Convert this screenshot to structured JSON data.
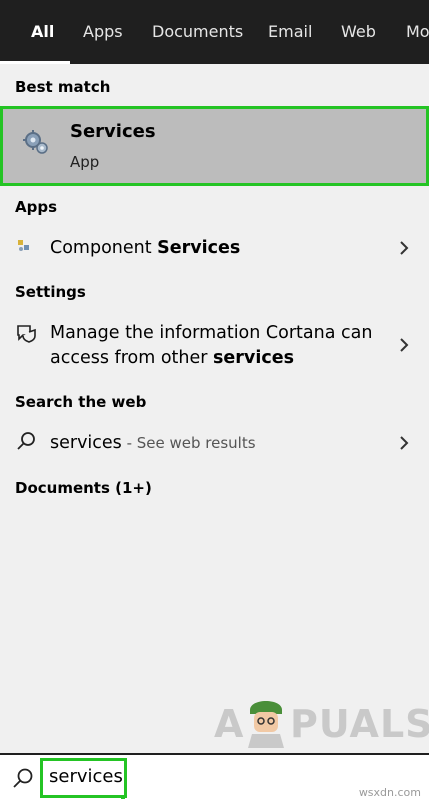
{
  "tabs": [
    {
      "label": "All",
      "active": true
    },
    {
      "label": "Apps",
      "active": false
    },
    {
      "label": "Documents",
      "active": false
    },
    {
      "label": "Email",
      "active": false
    },
    {
      "label": "Web",
      "active": false
    },
    {
      "label": "Mo",
      "active": false
    }
  ],
  "sections": {
    "best_match": "Best match",
    "apps": "Apps",
    "settings": "Settings",
    "search_web": "Search the web",
    "documents": "Documents (1+)"
  },
  "best_match": {
    "title": "Services",
    "subtitle": "App",
    "icon": "gear-icon"
  },
  "apps": [
    {
      "prefix": "Component ",
      "bold": "Services",
      "icon": "component-services-icon"
    }
  ],
  "settings": [
    {
      "line1": "Manage the information Cortana can",
      "line2_prefix": "access from other ",
      "line2_bold": "services",
      "icon": "chat-shield-icon"
    }
  ],
  "web": [
    {
      "query": "services",
      "suffix": " - See web results",
      "icon": "search-icon"
    }
  ],
  "logo": {
    "text_left": "A",
    "text_right": "PUALS"
  },
  "watermark": "wsxdn.com",
  "search": {
    "value": "services"
  },
  "colors": {
    "highlight": "#24c424",
    "tabbar": "#1f1f1f",
    "selected_bg": "#bcbcbc"
  }
}
